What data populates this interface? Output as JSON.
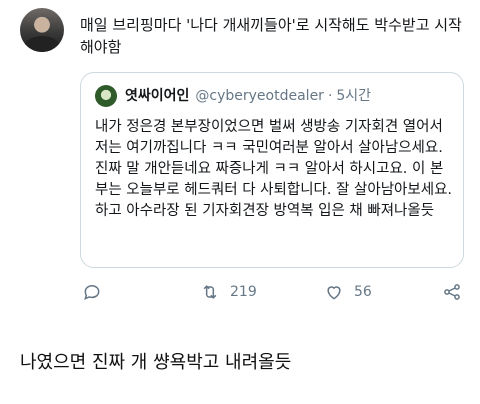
{
  "tweet": {
    "text": "매일 브리핑마다 '나다 개새끼들아'로 시작해도 박수받고 시작해야함"
  },
  "quote": {
    "display_name": "엿싸이어인",
    "handle": "@cyberyeotdealer",
    "separator": "·",
    "time": "5시간",
    "body": "내가 정은경 본부장이었으면 벌써 생방송 기자회견 열어서\n저는 여기까집니다 ㅋㅋ 국민여러분 알아서 살아남으세요. 진짜 말 개안듣네요 짜증나게 ㅋㅋ 알아서 하시고요. 이 본부는 오늘부로 헤드쿼터 다 사퇴합니다. 잘 살아남아보세요. 하고 아수라장 된 기자회견장 방역복 입은 채 빠져나올듯"
  },
  "actions": {
    "reply_icon": "reply-icon",
    "retweet_icon": "retweet-icon",
    "retweet_count": "219",
    "like_icon": "heart-icon",
    "like_count": "56",
    "share_icon": "share-icon"
  },
  "comment": {
    "text": "나였으면 진짜 개 썅욕박고 내려올듯"
  }
}
